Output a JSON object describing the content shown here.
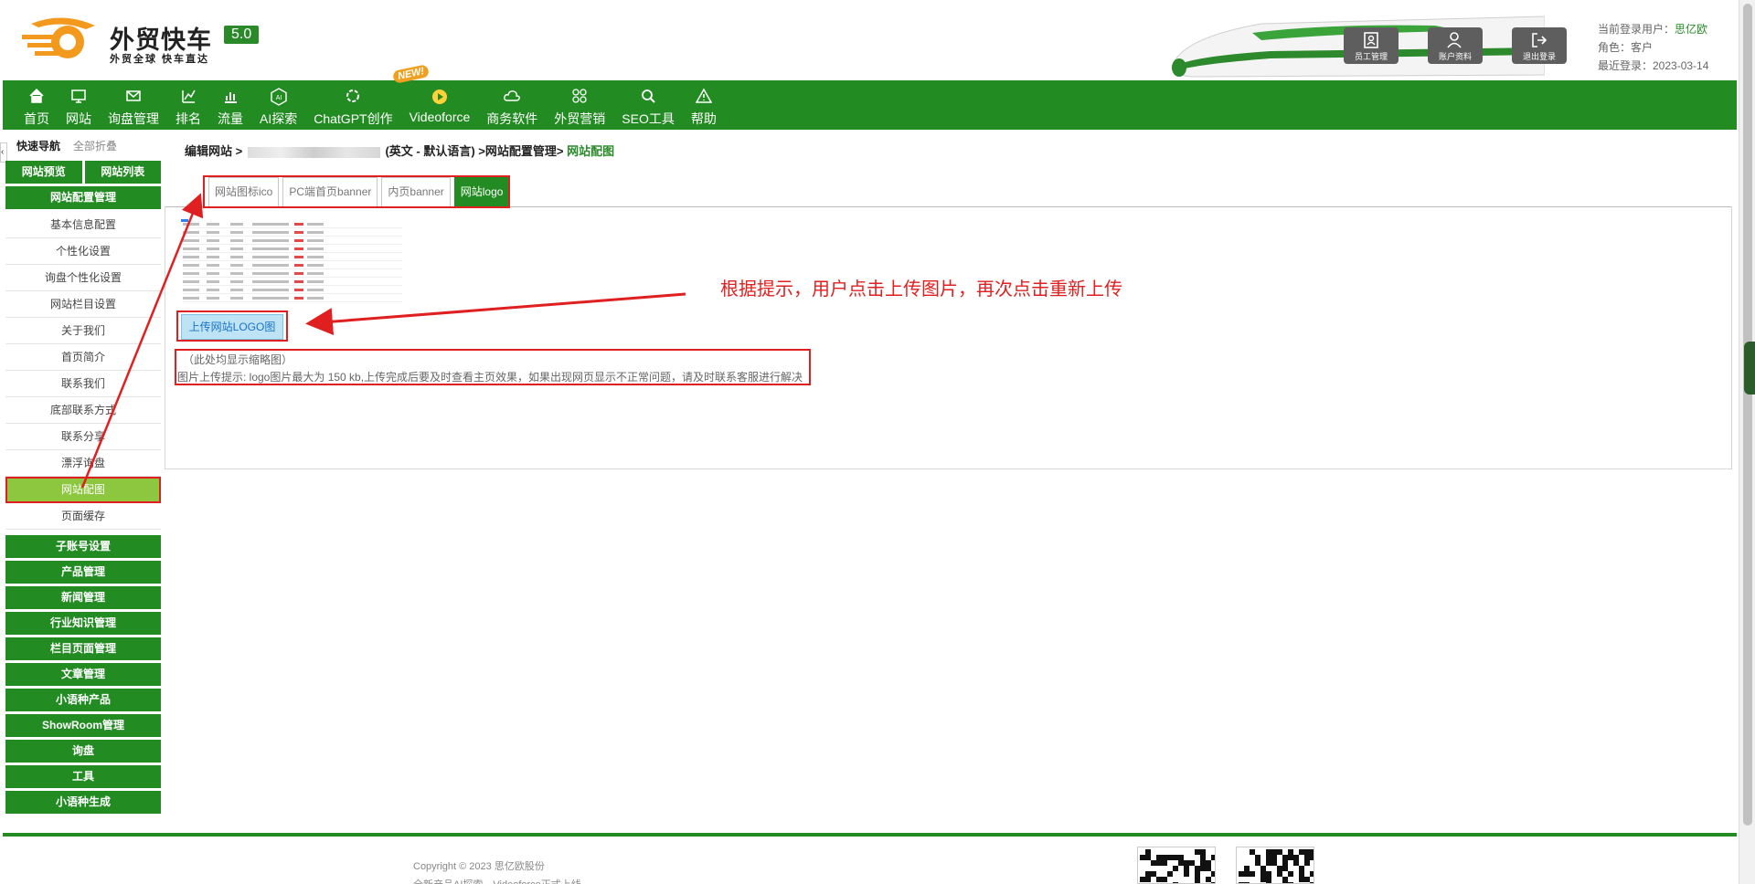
{
  "brand": {
    "title": "外贸快车",
    "version": "5.0",
    "subtitle": "外贸全球 快车直达"
  },
  "header_buttons": [
    {
      "label": "员工管理",
      "icon": "staff-icon"
    },
    {
      "label": "账户资料",
      "icon": "account-icon"
    },
    {
      "label": "退出登录",
      "icon": "logout-icon"
    }
  ],
  "user": {
    "current_label": "当前登录用户：",
    "name": "思亿欧",
    "role": "角色：客户",
    "last_login": "最近登录：2023-03-14"
  },
  "nav": [
    {
      "label": "首页",
      "icon": "home-icon"
    },
    {
      "label": "网站",
      "icon": "monitor-icon"
    },
    {
      "label": "询盘管理",
      "icon": "mail-icon"
    },
    {
      "label": "排名",
      "icon": "ranking-icon"
    },
    {
      "label": "流量",
      "icon": "chart-icon"
    },
    {
      "label": "AI探索",
      "icon": "ai-icon"
    },
    {
      "label": "ChatGPT创作",
      "icon": "chatgpt-icon"
    },
    {
      "label": "Videoforce",
      "icon": "video-icon"
    },
    {
      "label": "商务软件",
      "icon": "cloud-icon"
    },
    {
      "label": "外贸营销",
      "icon": "grid-icon"
    },
    {
      "label": "SEO工具",
      "icon": "search-icon"
    },
    {
      "label": "帮助",
      "icon": "warning-icon"
    }
  ],
  "new_badge": "NEW!",
  "sidebar": {
    "tab_active": "快速导航",
    "tab_inactive": "全部折叠",
    "top_buttons": [
      "网站预览",
      "网站列表"
    ],
    "section_title": "网站配置管理",
    "sub_items": [
      "基本信息配置",
      "个性化设置",
      "询盘个性化设置",
      "网站栏目设置",
      "关于我们",
      "首页简介",
      "联系我们",
      "底部联系方式",
      "联系分享",
      "漂浮询盘",
      "网站配图",
      "页面缓存"
    ],
    "active_item": "网站配图",
    "groups": [
      "子账号设置",
      "产品管理",
      "新闻管理",
      "行业知识管理",
      "栏目页面管理",
      "文章管理",
      "小语种产品",
      "ShowRoom管理",
      "询盘",
      "工具",
      "小语种生成"
    ]
  },
  "breadcrumb": {
    "prefix": "编辑网站 >",
    "middle": "(英文 - 默认语言) >网站配置管理>",
    "current": "网站配图"
  },
  "tabs": [
    {
      "label": "网站图标ico",
      "active": false
    },
    {
      "label": "PC端首页banner",
      "active": false
    },
    {
      "label": "内页banner",
      "active": false
    },
    {
      "label": "网站logo",
      "active": true
    }
  ],
  "upload_button": "上传网站LOGO图",
  "hint_thumbnail": "（此处均显示缩略图）",
  "hint_upload": "图片上传提示: logo图片最大为 150 kb,上传完成后要及时查看主页效果，如果出现网页显示不正常问题，请及时联系客服进行解决",
  "annotation": "根据提示，用户点击上传图片，再次点击重新上传",
  "footer": {
    "copyright": "Copyright © 2023 思亿欧股份",
    "news": "全新产品AI探索，Videoforce正式上线"
  },
  "colors": {
    "primary": "#228b22",
    "accent_red": "#e02020",
    "active_item": "#8dc63f",
    "upload_bg": "#bde3f5"
  }
}
